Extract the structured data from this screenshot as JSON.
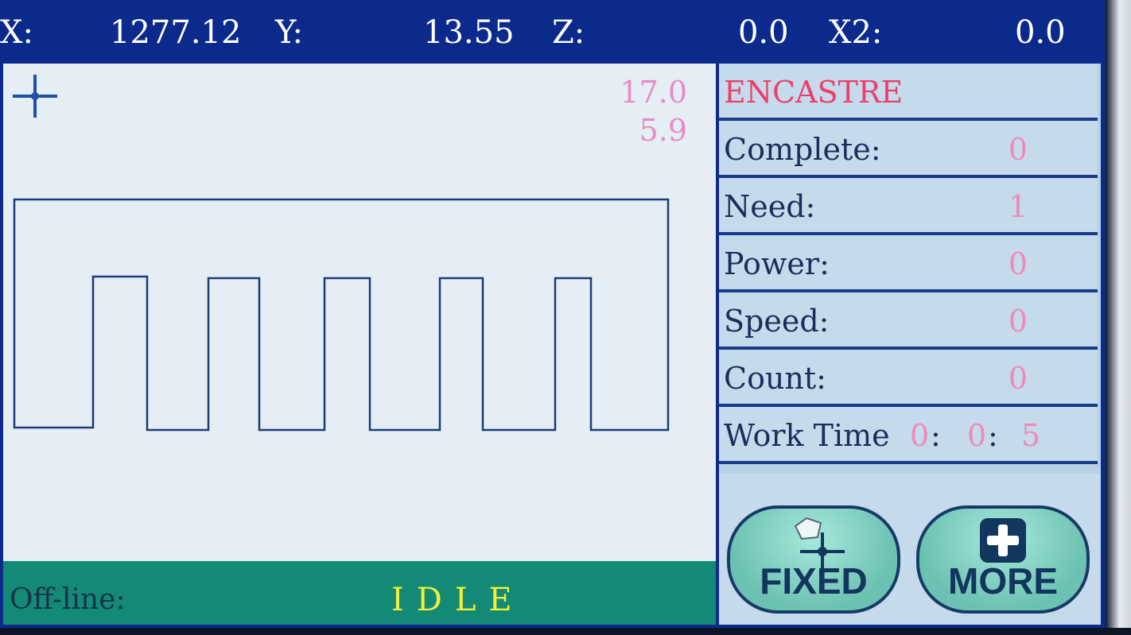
{
  "coords": {
    "x_label": "X:",
    "x_value": "1277.12",
    "y_label": "Y:",
    "y_value": "13.55",
    "z_label": "Z:",
    "z_value": "0.0",
    "x2_label": "X2:",
    "x2_value": "0.0"
  },
  "canvas": {
    "readout_top": "17.0",
    "readout_bottom": "5.9",
    "origin_marker_icon": "crosshair-icon"
  },
  "status": {
    "mode_label": "Off-line:",
    "state": "IDLE"
  },
  "panel": {
    "file_name": "ENCASTRE",
    "complete_label": "Complete:",
    "complete_value": "0",
    "need_label": "Need:",
    "need_value": "1",
    "power_label": "Power:",
    "power_value": "0",
    "speed_label": "Speed:",
    "speed_value": "0",
    "count_label": "Count:",
    "count_value": "0",
    "worktime_label": "Work Time",
    "worktime_h": "0",
    "worktime_m": "0",
    "worktime_s": "5"
  },
  "buttons": {
    "fixed_label": "FIXED",
    "fixed_icon": "fixed-point-icon",
    "more_label": "MORE",
    "more_icon": "plus-icon"
  },
  "colors": {
    "top_bar": "#0b2a8c",
    "canvas_bg": "#e4eef4",
    "status_bar": "#138a76",
    "state_text": "#f2ef3a",
    "value_text": "#f089b8",
    "title_text": "#ec3f6a"
  }
}
